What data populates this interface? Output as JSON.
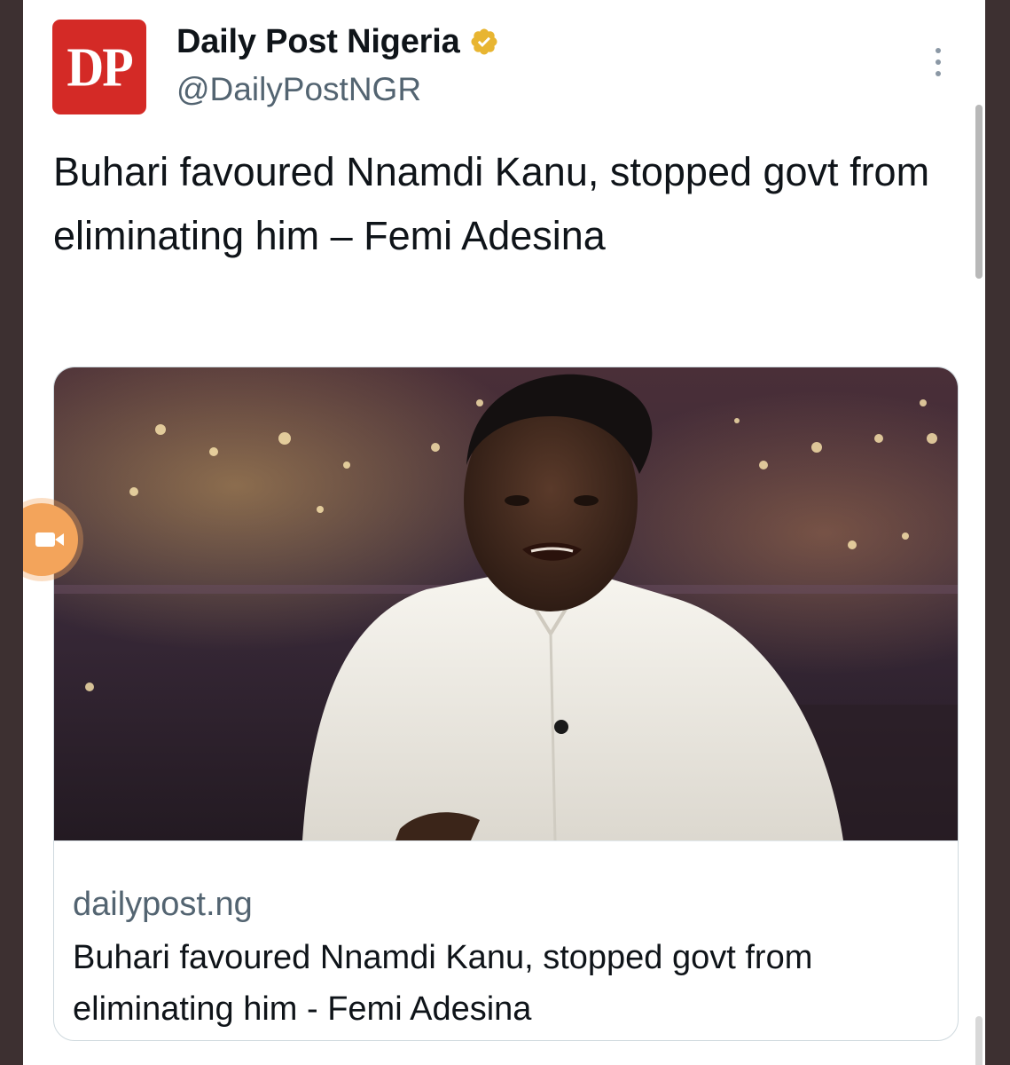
{
  "tweet": {
    "author": {
      "avatar_text": "DP",
      "display_name": "Daily Post Nigeria",
      "handle": "@DailyPostNGR",
      "verified": true
    },
    "text": "Buhari favoured Nnamdi Kanu, stopped govt from eliminating him – Femi Adesina",
    "link_card": {
      "domain": "dailypost.ng",
      "title": "Buhari favoured Nnamdi Kanu, stopped govt from eliminating him - Femi Adesina"
    }
  },
  "colors": {
    "avatar_bg": "#d42a26",
    "verified_badge": "#e8b531",
    "text_primary": "#0f1419",
    "text_secondary": "#536471",
    "frame": "#3d3031",
    "floating_button": "#f3a45b"
  },
  "icons": [
    "verified-badge-icon",
    "more-options-icon",
    "video-record-icon"
  ]
}
